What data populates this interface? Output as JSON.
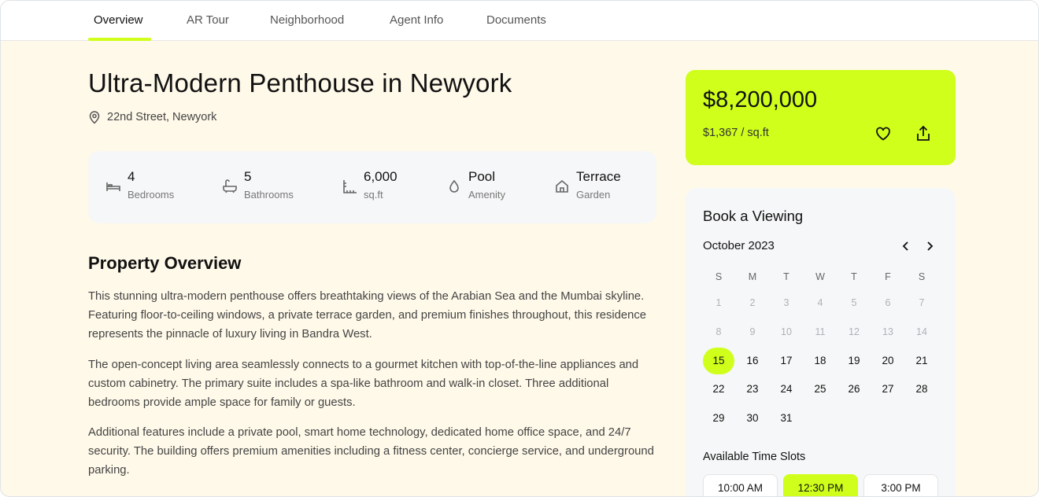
{
  "tabs": [
    "Overview",
    "AR Tour",
    "Neighborhood",
    "Agent Info",
    "Documents"
  ],
  "property": {
    "title": "Ultra-Modern Penthouse in Newyork",
    "address": "22nd Street, Newyork"
  },
  "stats": [
    {
      "value": "4",
      "label": "Bedrooms",
      "icon": "bed-icon"
    },
    {
      "value": "5",
      "label": "Bathrooms",
      "icon": "bath-icon"
    },
    {
      "value": "6,000",
      "label": "sq.ft",
      "icon": "ruler-icon"
    },
    {
      "value": "Pool",
      "label": "Amenity",
      "icon": "water-drop-icon"
    },
    {
      "value": "Terrace",
      "label": "Garden",
      "icon": "home-icon"
    }
  ],
  "overview": {
    "heading": "Property Overview",
    "paragraphs": [
      "This stunning ultra-modern penthouse offers breathtaking views of the Arabian Sea and the Mumbai skyline. Featuring floor-to-ceiling windows, a private terrace garden, and premium finishes throughout, this residence represents the pinnacle of luxury living in Bandra West.",
      "The open-concept living area seamlessly connects to a gourmet kitchen with top-of-the-line appliances and custom cabinetry. The primary suite includes a spa-like bathroom and walk-in closet. Three additional bedrooms provide ample space for family or guests.",
      "Additional features include a private pool, smart home technology, dedicated home office space, and 24/7 security. The building offers premium amenities including a fitness center, concierge service, and underground parking."
    ]
  },
  "price": {
    "amount": "$8,200,000",
    "per_sqft": "$1,367 / sq.ft"
  },
  "booking": {
    "title": "Book a Viewing",
    "month": "October 2023",
    "weekdays": [
      "S",
      "M",
      "T",
      "W",
      "T",
      "F",
      "S"
    ],
    "days": [
      [
        "1",
        "2",
        "3",
        "4",
        "5",
        "6",
        "7"
      ],
      [
        "8",
        "9",
        "10",
        "11",
        "12",
        "13",
        "14"
      ],
      [
        "15",
        "16",
        "17",
        "18",
        "19",
        "20",
        "21"
      ],
      [
        "22",
        "23",
        "24",
        "25",
        "26",
        "27",
        "28"
      ],
      [
        "29",
        "30",
        "31"
      ]
    ],
    "selected_day": "15",
    "slots_title": "Available Time Slots",
    "slots": [
      "10:00 AM",
      "12:30 PM",
      "3:00 PM"
    ],
    "selected_slot": "12:30 PM"
  },
  "colors": {
    "accent": "#cfff1a",
    "page_bg": "#fff9e9",
    "card_bg": "#f6f7f8"
  }
}
